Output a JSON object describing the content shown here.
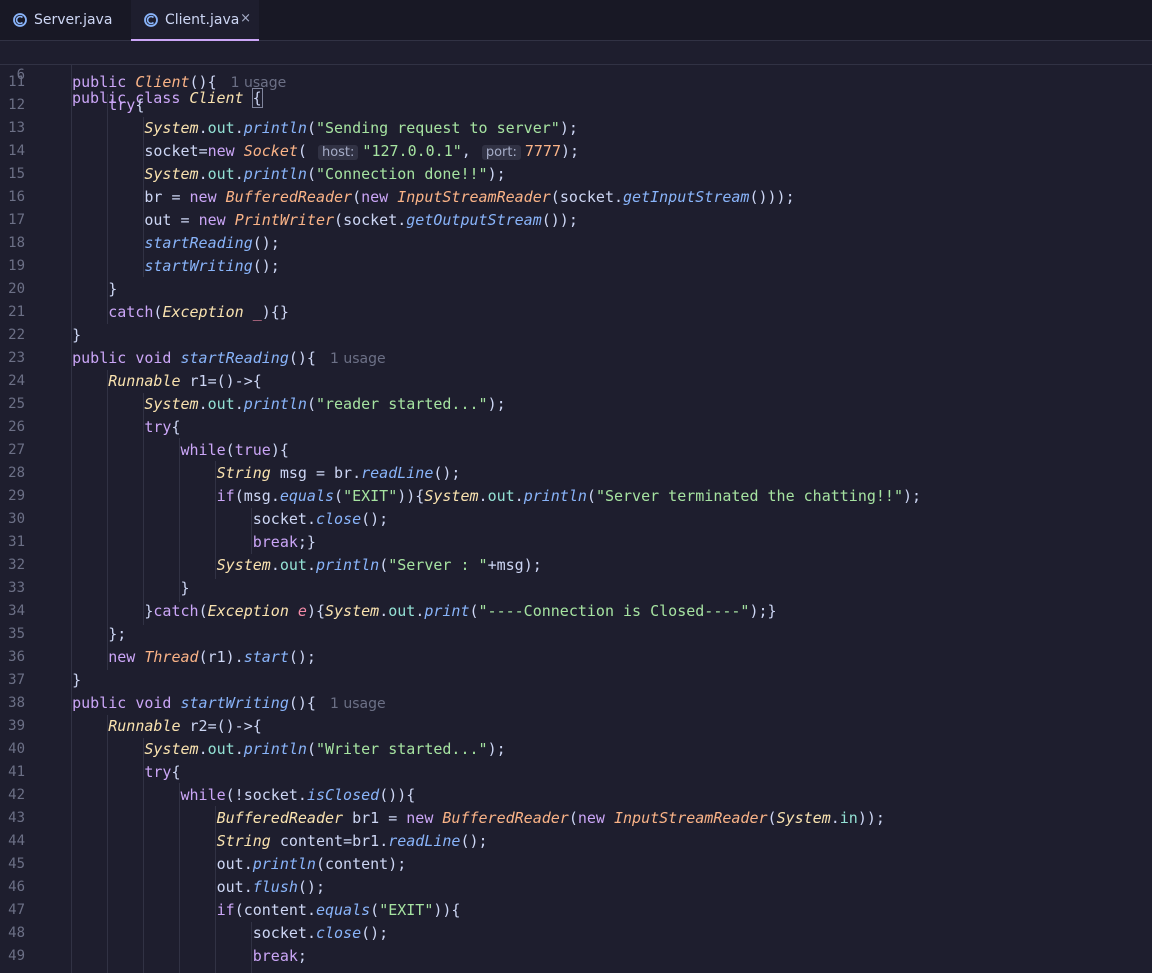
{
  "tabs": [
    {
      "label": "Server.java",
      "icon": "java-class-icon",
      "active": false
    },
    {
      "label": "Client.java",
      "icon": "java-class-icon",
      "active": true
    }
  ],
  "tab_close_glyph": "×",
  "colors": {
    "keyword": "#cba6f7",
    "class": "#f9e2af",
    "method": "#89b4fa",
    "string": "#a6e3a1",
    "number": "#fab387",
    "line_number": "#6c7086",
    "active_tab_underline": "#cba6f7"
  },
  "sticky_line": {
    "number": "6",
    "code": "public class Client {"
  },
  "lines": [
    {
      "n": "11",
      "text": "    public Client(){  1 usage"
    },
    {
      "n": "12",
      "text": "        try{"
    },
    {
      "n": "13",
      "text": "            System.out.println(\"Sending request to server\");"
    },
    {
      "n": "14",
      "text": "            socket=new Socket( host: \"127.0.0.1\", port: 7777);"
    },
    {
      "n": "15",
      "text": "            System.out.println(\"Connection done!!\");"
    },
    {
      "n": "16",
      "text": "            br = new BufferedReader(new InputStreamReader(socket.getInputStream()));"
    },
    {
      "n": "17",
      "text": "            out = new PrintWriter(socket.getOutputStream());"
    },
    {
      "n": "18",
      "text": "            startReading();"
    },
    {
      "n": "19",
      "text": "            startWriting();"
    },
    {
      "n": "20",
      "text": "        }"
    },
    {
      "n": "21",
      "text": "        catch(Exception _){}"
    },
    {
      "n": "22",
      "text": "    }"
    },
    {
      "n": "23",
      "text": "    public void startReading(){  1 usage"
    },
    {
      "n": "24",
      "text": "        Runnable r1=()->{"
    },
    {
      "n": "25",
      "text": "            System.out.println(\"reader started...\");"
    },
    {
      "n": "26",
      "text": "            try{"
    },
    {
      "n": "27",
      "text": "                while(true){"
    },
    {
      "n": "28",
      "text": "                    String msg = br.readLine();"
    },
    {
      "n": "29",
      "text": "                    if(msg.equals(\"EXIT\")){System.out.println(\"Server terminated the chatting!!\");"
    },
    {
      "n": "30",
      "text": "                        socket.close();"
    },
    {
      "n": "31",
      "text": "                        break;}"
    },
    {
      "n": "32",
      "text": "                    System.out.println(\"Server : \"+msg);"
    },
    {
      "n": "33",
      "text": "                }"
    },
    {
      "n": "34",
      "text": "            }catch(Exception e){System.out.print(\"----Connection is Closed----\");}"
    },
    {
      "n": "35",
      "text": "        };"
    },
    {
      "n": "36",
      "text": "        new Thread(r1).start();"
    },
    {
      "n": "37",
      "text": "    }"
    },
    {
      "n": "38",
      "text": "    public void startWriting(){  1 usage"
    },
    {
      "n": "39",
      "text": "        Runnable r2=()->{"
    },
    {
      "n": "40",
      "text": "            System.out.println(\"Writer started...\");"
    },
    {
      "n": "41",
      "text": "            try{"
    },
    {
      "n": "42",
      "text": "                while(!socket.isClosed()){"
    },
    {
      "n": "43",
      "text": "                    BufferedReader br1 = new BufferedReader(new InputStreamReader(System.in));"
    },
    {
      "n": "44",
      "text": "                    String content=br1.readLine();"
    },
    {
      "n": "45",
      "text": "                    out.println(content);"
    },
    {
      "n": "46",
      "text": "                    out.flush();"
    },
    {
      "n": "47",
      "text": "                    if(content.equals(\"EXIT\")){"
    },
    {
      "n": "48",
      "text": "                        socket.close();"
    },
    {
      "n": "49",
      "text": "                        break;"
    }
  ]
}
